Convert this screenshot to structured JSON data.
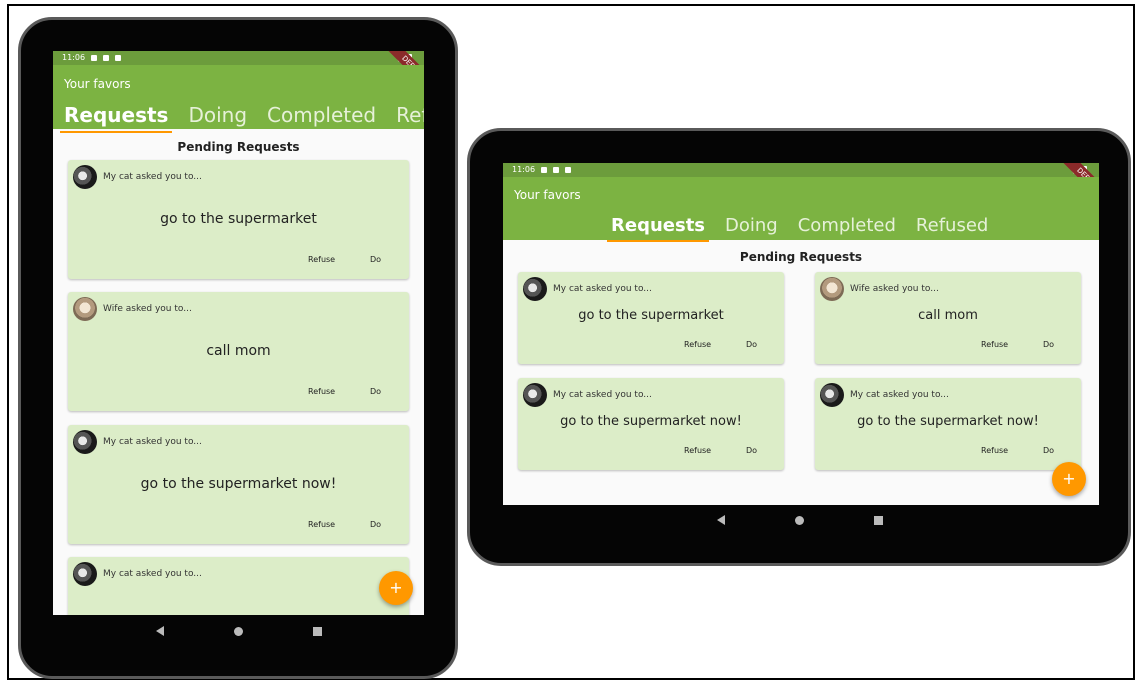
{
  "status": {
    "time": "11:06"
  },
  "debug_label": "DEBUG",
  "appbar": {
    "title": "Your favors"
  },
  "tabs": [
    "Requests",
    "Doing",
    "Completed",
    "Refused"
  ],
  "section_title": "Pending Requests",
  "cards": [
    {
      "asked": "My cat asked you to...",
      "task": "go to the supermarket",
      "avatar": "cat-avatar"
    },
    {
      "asked": "Wife asked you to...",
      "task": "call mom",
      "avatar": "wife-avatar"
    },
    {
      "asked": "My cat asked you to...",
      "task": "go to the supermarket now!",
      "avatar": "cat-avatar"
    },
    {
      "asked": "My cat asked you to...",
      "task": "go to the supermarket now!",
      "avatar": "cat-avatar"
    }
  ],
  "buttons": {
    "refuse": "Refuse",
    "do": "Do"
  },
  "fab_label": "+",
  "colors": {
    "appbar": "#7cb342",
    "statusbar": "#6c9c3c",
    "card": "#dcedc8",
    "tab_indicator": "#ff9800",
    "fab": "#ff9800"
  }
}
